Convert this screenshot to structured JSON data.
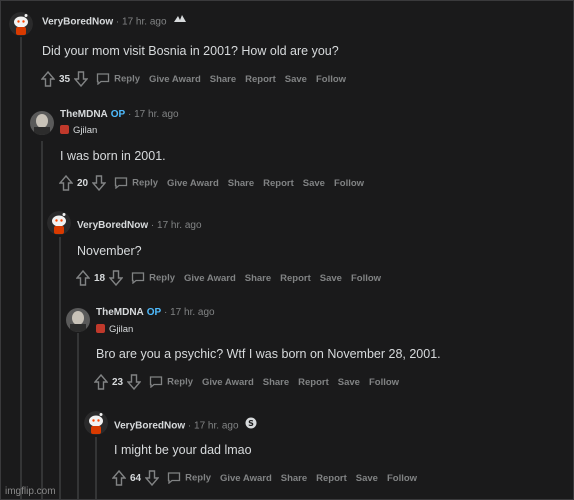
{
  "comments": [
    {
      "user": "VeryBoredNow",
      "op": "",
      "flair": "",
      "time": "17 hr. ago",
      "text": "Did your mom visit Bosnia in 2001? How old are you?",
      "score": "35"
    },
    {
      "user": "TheMDNA",
      "op": "OP",
      "flair": "Gjilan",
      "time": "17 hr. ago",
      "text": "I was born in 2001.",
      "score": "20"
    },
    {
      "user": "VeryBoredNow",
      "op": "",
      "flair": "",
      "time": "17 hr. ago",
      "text": "November?",
      "score": "18"
    },
    {
      "user": "TheMDNA",
      "op": "OP",
      "flair": "Gjilan",
      "time": "17 hr. ago",
      "text": "Bro are you a psychic? Wtf I was born on November 28, 2001.",
      "score": "23"
    },
    {
      "user": "VeryBoredNow",
      "op": "",
      "flair": "",
      "time": "17 hr. ago",
      "text": "I might be your dad lmao",
      "score": "64"
    }
  ],
  "actions": {
    "reply": "Reply",
    "give_award": "Give Award",
    "share": "Share",
    "report": "Report",
    "save": "Save",
    "follow": "Follow"
  },
  "icons": {
    "upvote": "arrow-up-icon",
    "downvote": "arrow-down-icon",
    "reply": "speech-bubble-icon"
  },
  "watermark": "imgflip.com",
  "colors": {
    "background": "#1a1a1b",
    "text": "#d7dadc",
    "muted": "#818384",
    "op": "#4fbcff"
  }
}
